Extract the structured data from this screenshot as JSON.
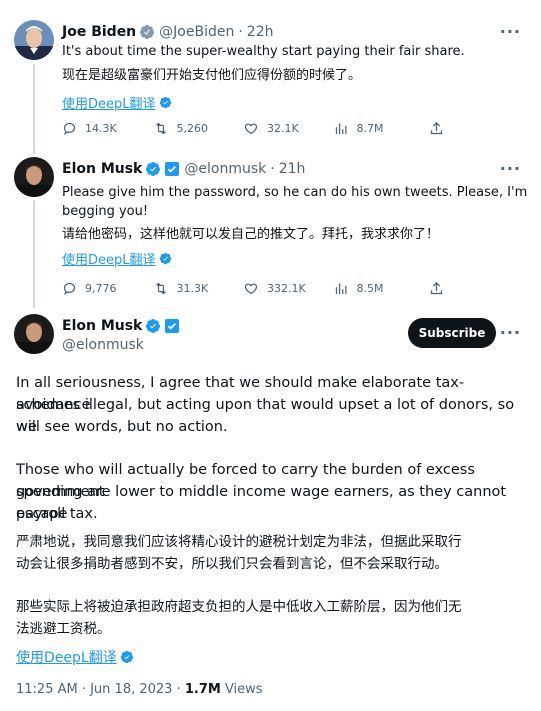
{
  "tweet1": {
    "name": "Joe Biden",
    "handle": "@JoeBiden",
    "time": "22h",
    "text_en": "It's about time the super-wealthy start paying their fair share.",
    "text_zh": "现在是超级富豪们开始支付他们应得份额的时候了。",
    "translate_label": "使用DeepL翻译",
    "replies": "14.3K",
    "retweets": "5,260",
    "likes": "32.1K",
    "views": "8.7M"
  },
  "tweet2": {
    "name": "Elon Musk",
    "handle": "@elonmusk",
    "time": "21h",
    "text_en_1": "Please give him the password, so he can do his own tweets. Please, I'm",
    "text_en_2": "begging you!",
    "text_zh": "请给他密码，这样他就可以发自己的推文了。拜托，我求求你了！",
    "translate_label": "使用DeepL翻译",
    "replies": "9,776",
    "retweets": "31.3K",
    "likes": "332.1K",
    "views": "8.5M"
  },
  "tweet3": {
    "name": "Elon Musk",
    "handle": "@elonmusk",
    "subscribe_label": "Subscribe",
    "para1_l1": "In all seriousness, I agree that we should make elaborate tax-avoidance",
    "para1_l2": "schemes illegal, but acting upon that would upset a lot of donors, so we",
    "para1_l3": "will see words, but no action.",
    "para2_l1": "Those who will actually be forced to carry the burden of excess government",
    "para2_l2": "spending are lower to middle income wage earners, as they cannot escape",
    "para2_l3": "payroll tax.",
    "zh1_l1": "严肃地说，我同意我们应该将精心设计的避税计划定为非法，但据此采取行",
    "zh1_l2": "动会让很多捐助者感到不安，所以我们只会看到言论，但不会采取行动。",
    "zh2_l1": "那些实际上将被迫承担政府超支负担的人是中低收入工薪阶层，因为他们无",
    "zh2_l2": "法逃避工资税。",
    "translate_label": "使用DeepL翻译",
    "timestamp": "11:25 AM · Jun 18, 2023 · ",
    "views_count": "1.7M",
    "views_label": " Views"
  },
  "colors": {
    "accent": "#1d9bf0",
    "verified_gold": "#e2b719",
    "text": "#0f1419",
    "muted": "#536471"
  }
}
